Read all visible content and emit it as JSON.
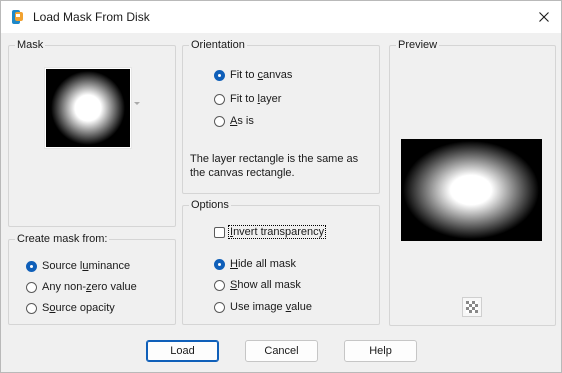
{
  "window": {
    "title": "Load Mask From Disk"
  },
  "mask": {
    "legend": "Mask"
  },
  "orientation": {
    "legend": "Orientation",
    "options": [
      {
        "pre": "Fit to ",
        "acc": "c",
        "post": "anvas",
        "selected": true
      },
      {
        "pre": "Fit to ",
        "acc": "l",
        "post": "ayer",
        "selected": false
      },
      {
        "pre": "",
        "acc": "A",
        "post": "s is",
        "selected": false
      }
    ],
    "description_line1": "The layer rectangle is the same as",
    "description_line2": "the canvas rectangle."
  },
  "options_group": {
    "legend": "Options",
    "invert": {
      "pre": "",
      "acc": "I",
      "post": "nvert transparency",
      "checked": false
    },
    "radios": [
      {
        "pre": "",
        "acc": "H",
        "post": "ide all mask",
        "selected": true
      },
      {
        "pre": "",
        "acc": "S",
        "post": "how all mask",
        "selected": false
      },
      {
        "pre": "Use image ",
        "acc": "v",
        "post": "alue",
        "selected": false
      }
    ]
  },
  "create_from": {
    "legend": "Create mask from:",
    "options": [
      {
        "pre": "Source l",
        "acc": "u",
        "post": "minance",
        "selected": true
      },
      {
        "pre": "Any non-",
        "acc": "z",
        "post": "ero value",
        "selected": false
      },
      {
        "pre": "S",
        "acc": "o",
        "post": "urce opacity",
        "selected": false
      }
    ]
  },
  "preview": {
    "legend": "Preview"
  },
  "buttons": {
    "load": "Load",
    "cancel": "Cancel",
    "help": "Help"
  },
  "icons": {
    "app": "paintshop-icon",
    "close": "close-icon",
    "checker": "checkerboard-icon"
  },
  "colors": {
    "accent": "#0f5fb9",
    "window_bg": "#f0f0f0",
    "preview_bg": "#000000"
  }
}
